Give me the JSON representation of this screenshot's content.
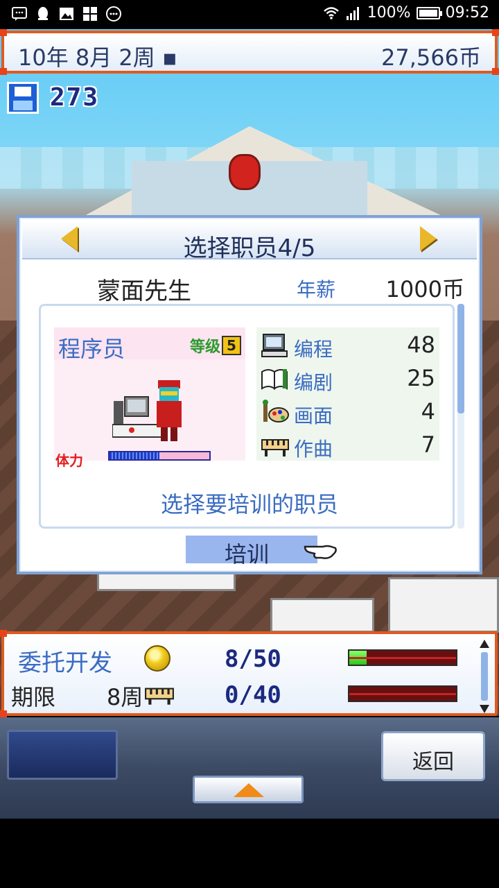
{
  "status_bar": {
    "battery": "100%",
    "time": "09:52"
  },
  "hud": {
    "date": "10年 8月 2周 ▪",
    "money": "27,566币",
    "save_count": "273"
  },
  "dialog": {
    "title": "选择职员4/5",
    "employee_name": "蒙面先生",
    "salary_label": "年薪",
    "salary_value": "1000币",
    "role": "程序员",
    "level_label": "等级",
    "level_value": "5",
    "stamina_label": "体力",
    "stamina_fraction": 0.5,
    "stats": [
      {
        "name": "编程",
        "value": "48",
        "icon": "computer-icon"
      },
      {
        "name": "编剧",
        "value": "25",
        "icon": "book-pen-icon"
      },
      {
        "name": "画面",
        "value": "4",
        "icon": "paint-palette-icon"
      },
      {
        "name": "作曲",
        "value": "7",
        "icon": "keyboard-instrument-icon"
      }
    ],
    "hint": "选择要培训的职员",
    "train_button": "培训"
  },
  "task": {
    "label": "委托开发",
    "progress_1": "8/50",
    "progress_1_fraction": 0.16,
    "deadline_label": "期限",
    "deadline_value": "8周",
    "progress_2": "0/40",
    "progress_2_fraction": 0
  },
  "controls": {
    "back_button": "返回"
  },
  "colors": {
    "frame_orange": "#e05a20",
    "text_blue": "#3a6cc2",
    "dark_navy": "#1b2a80"
  }
}
